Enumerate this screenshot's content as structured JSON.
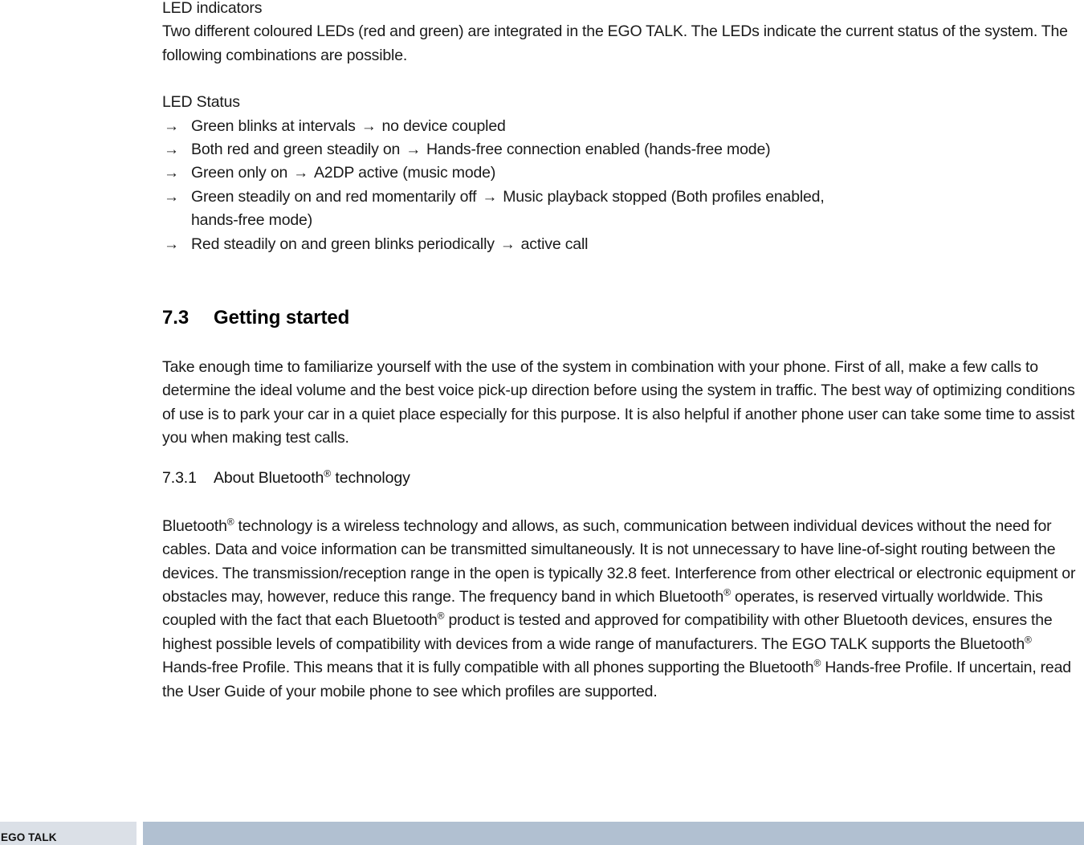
{
  "document": {
    "footer": {
      "product_label": "EGO TALK",
      "band_left_color": "#dbe0e7",
      "band_right_color": "#b1c0d1"
    },
    "led_section": {
      "title": "LED indicators",
      "intro": "Two different coloured LEDs (red and green) are integrated in the EGO TALK. The LEDs indicate the current status of the system. The following combinations are possible.",
      "status_heading": "LED Status",
      "arrow_glyph": "→",
      "status_items": [
        {
          "condition": "Green blinks at intervals",
          "result": "no device coupled",
          "result_wrap": ""
        },
        {
          "condition": "Both red and green steadily on",
          "result": "Hands-free connection enabled (hands-free mode)",
          "result_wrap": ""
        },
        {
          "condition": "Green only on",
          "result": "A2DP active (music mode)",
          "result_wrap": ""
        },
        {
          "condition": "Green steadily on and red momentarily off",
          "result": "Music playback stopped (Both profiles enabled,",
          "result_wrap": "hands-free mode)"
        },
        {
          "condition": "Red steadily on and green blinks periodically",
          "result": "active call",
          "result_wrap": ""
        }
      ]
    },
    "getting_started": {
      "number": "7.3",
      "title": "Getting started",
      "body": "Take enough time to familiarize yourself with the use of the system in combination with your phone. First of all, make a few calls to determine the ideal volume and the best voice pick-up direction before using the system in traffic. The best way of optimizing conditions of use is to park your car in a quiet place especially for this purpose. It is also helpful if another phone user can take some time to assist you when making test calls."
    },
    "bluetooth_section": {
      "number": "7.3.1",
      "title_before_reg": "About Bluetooth",
      "registered_mark": "®",
      "title_after_reg": " technology",
      "body_part_1": "Bluetooth",
      "body_part_2": " technology is a wireless technology and allows, as such, communication between individual devices without the need for cables. Data and voice information can be transmitted simultaneously. It is not unnecessary to have line-of-sight routing between the devices. The transmission/reception range in the open is typically 32.8 feet. Interference from other electrical or electronic equipment or obstacles may, however, reduce this range. The frequency band in which Bluetooth",
      "body_part_3": " operates, is reserved virtually worldwide. This coupled with the fact that each Bluetooth",
      "body_part_4": " product is tested and approved for compatibility with other Bluetooth devices, ensures the highest possible levels of compatibility with devices from a wide range of manufacturers. The EGO TALK supports the Bluetooth",
      "body_part_5": " Hands-free Profile. This means that it is fully compatible with all phones supporting the Bluetooth",
      "body_part_6": " Hands-free Profile. If uncertain, read the User Guide of your mobile phone to see which profiles are supported."
    }
  }
}
